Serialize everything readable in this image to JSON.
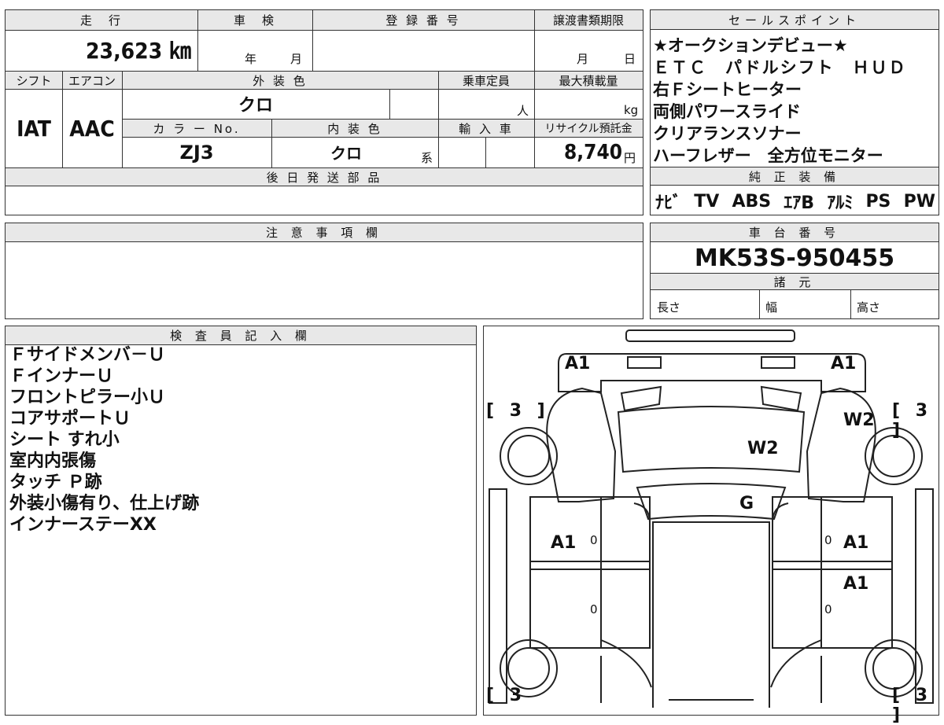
{
  "header": {
    "mileage_label": "走　行",
    "inspection_label": "車　検",
    "registration_label": "登 録 番 号",
    "transfer_deadline_label": "譲渡書類期限",
    "mileage_value": "23,623 ㎞",
    "year_unit": "年",
    "month_unit": "月",
    "deadline_month_unit": "月",
    "deadline_day_unit": "日"
  },
  "specs": {
    "shift_label": "シフト",
    "aircon_label": "エアコン",
    "exterior_color_label": "外 装 色",
    "capacity_label": "乗車定員",
    "max_load_label": "最大積載量",
    "shift_value": "IAT",
    "aircon_value": "AAC",
    "exterior_color_value": "クロ",
    "capacity_unit": "人",
    "max_load_unit": "kg",
    "color_no_label": "カ ラ ー No.",
    "interior_color_label": "内 装 色",
    "import_label": "輸 入 車",
    "recycle_label": "リサイクル預託金",
    "color_no_value": "ZJ3",
    "interior_color_value": "クロ",
    "interior_suffix": "系",
    "recycle_value": "8,740",
    "recycle_unit": "円",
    "later_parts_label": "後 日 発 送 部 品"
  },
  "sales_points": {
    "label": "セールスポイント",
    "lines": [
      "★オークションデビュー★",
      "ＥＴＣ　パドルシフト　ＨＵＤ",
      "右Ｆシートヒーター",
      "両側パワースライド",
      "クリアランスソナー",
      "ハーフレザー　全方位モニター"
    ]
  },
  "equipment": {
    "label": "純 正 装 備",
    "items": [
      "ﾅﾋﾞ",
      "TV",
      "ABS",
      "ｴｱB",
      "ｱﾙﾐ",
      "PS",
      "PW"
    ]
  },
  "notes": {
    "label": "注 意 事 項 欄"
  },
  "chassis": {
    "label": "車 台 番 号",
    "value": "MK53S-950455",
    "specs_label": "諸 元",
    "length_label": "長さ",
    "width_label": "幅",
    "height_label": "高さ"
  },
  "inspector": {
    "label": "検 査 員 記 入 欄",
    "lines": [
      "Ｆサイドメンバ－Ｕ",
      "ＦインナーＵ",
      "フロントピラー小Ｕ",
      "コアサポートＵ",
      "シート すれ小",
      "室内内張傷",
      "タッチ Ｐ跡",
      "外装小傷有り、仕上げ跡",
      "インナーステーXX"
    ]
  },
  "diagram": {
    "marks": {
      "front_left": "A1",
      "front_right": "A1",
      "right_front_fender": "W2",
      "hood": "W2",
      "windshield": "G",
      "left_front_door": "A1",
      "right_front_door": "A1",
      "right_rear_door": "A1"
    },
    "tire_fl": "[ 3 ]",
    "tire_fr": "[ 3 ]",
    "tire_rl": "[ 3",
    "tire_rr": "[ 3 ]",
    "zero": "0"
  }
}
